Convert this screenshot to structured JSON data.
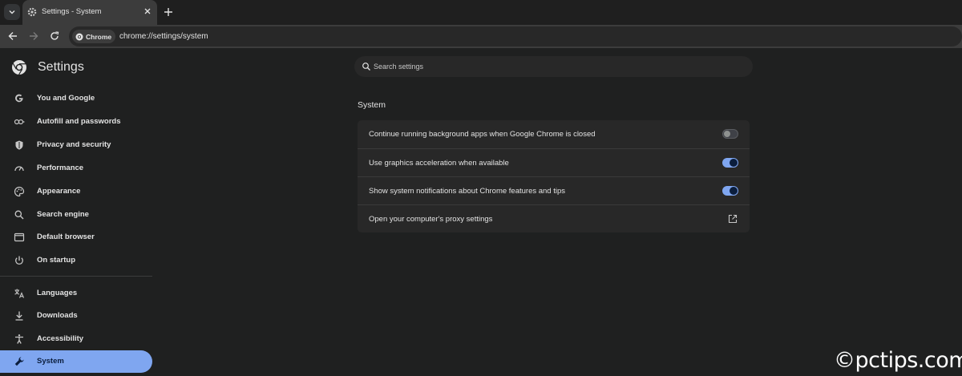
{
  "browser": {
    "tab_title": "Settings - System",
    "url": "chrome://settings/system",
    "chip_label": "Chrome"
  },
  "settings": {
    "brand_title": "Settings",
    "search_placeholder": "Search settings",
    "sidebar": [
      {
        "label": "You and Google",
        "icon": "google-g-icon"
      },
      {
        "label": "Autofill and passwords",
        "icon": "key-icon"
      },
      {
        "label": "Privacy and security",
        "icon": "shield-icon"
      },
      {
        "label": "Performance",
        "icon": "speedometer-icon"
      },
      {
        "label": "Appearance",
        "icon": "palette-icon"
      },
      {
        "label": "Search engine",
        "icon": "search-icon"
      },
      {
        "label": "Default browser",
        "icon": "browser-window-icon"
      },
      {
        "label": "On startup",
        "icon": "power-icon"
      },
      {
        "label": "Languages",
        "icon": "translate-icon"
      },
      {
        "label": "Downloads",
        "icon": "download-icon"
      },
      {
        "label": "Accessibility",
        "icon": "accessibility-icon"
      },
      {
        "label": "System",
        "icon": "wrench-icon",
        "active": true
      }
    ],
    "section_title": "System",
    "rows": [
      {
        "label": "Continue running background apps when Google Chrome is closed",
        "control": "toggle",
        "enabled": false
      },
      {
        "label": "Use graphics acceleration when available",
        "control": "toggle",
        "enabled": true
      },
      {
        "label": "Show system notifications about Chrome features and tips",
        "control": "toggle",
        "enabled": true
      },
      {
        "label": "Open your computer's proxy settings",
        "control": "external-link"
      }
    ]
  },
  "watermark": "©pctips.com",
  "colors": {
    "accent": "#7fa6f0",
    "background": "#1f2020",
    "card": "#282828"
  }
}
